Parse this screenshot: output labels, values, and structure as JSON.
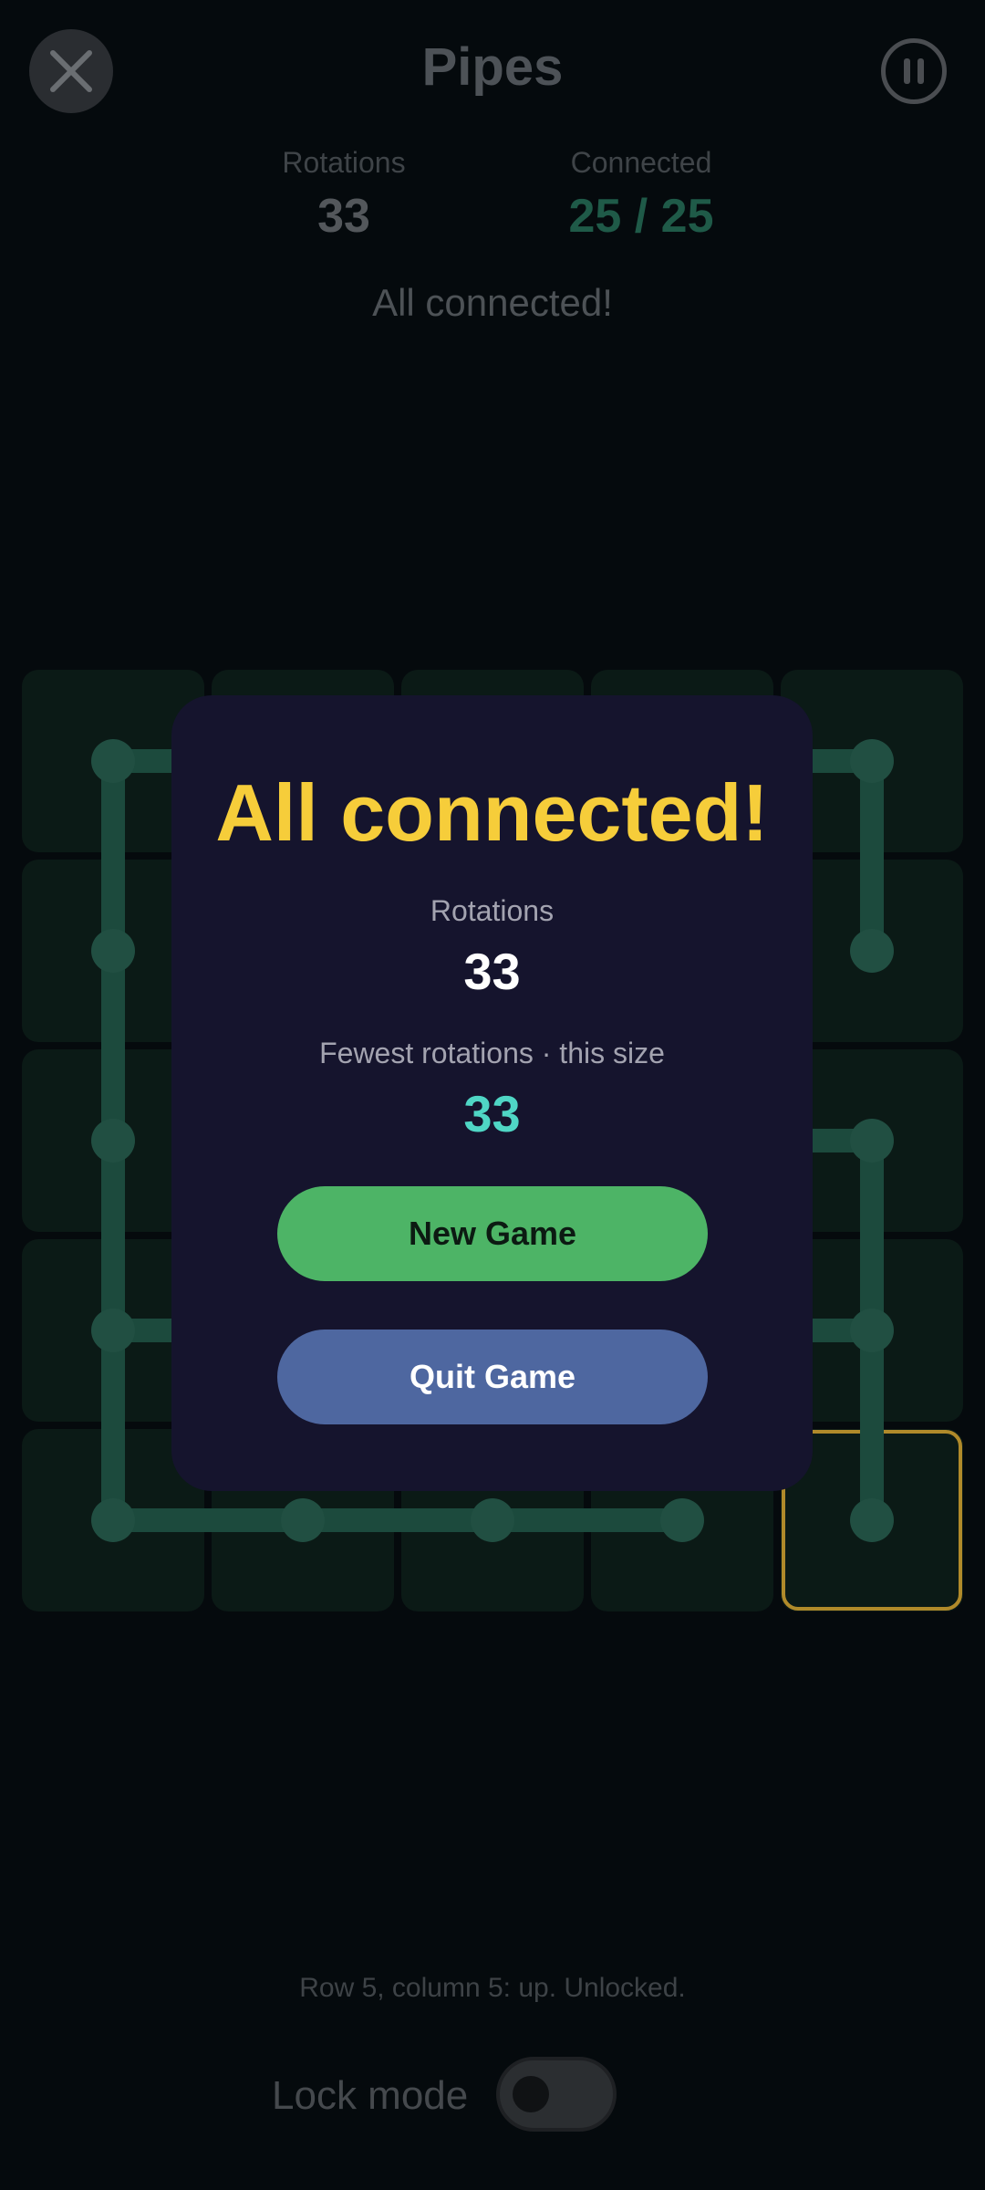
{
  "header": {
    "title": "Pipes",
    "close_icon": "close-icon",
    "pause_icon": "pause-icon"
  },
  "stats": {
    "rotations_label": "Rotations",
    "rotations_value": "33",
    "connected_label": "Connected",
    "connected_value": "25 / 25"
  },
  "status_message": "All connected!",
  "board": {
    "rows": 5,
    "cols": 5,
    "pipe_color": "#1c4a3d",
    "cell_color": "#0b1a16",
    "highlight_color": "#b08a2a",
    "selected_cell": {
      "row": 5,
      "col": 5
    }
  },
  "modal": {
    "title": "All connected!",
    "rotations_label": "Rotations",
    "rotations_value": "33",
    "best_label": "Fewest rotations · this size",
    "best_value": "33",
    "new_game_label": "New Game",
    "quit_game_label": "Quit Game"
  },
  "footer": {
    "cell_status": "Row 5, column 5: up. Unlocked.",
    "lock_mode_label": "Lock mode",
    "lock_mode_on": false
  }
}
